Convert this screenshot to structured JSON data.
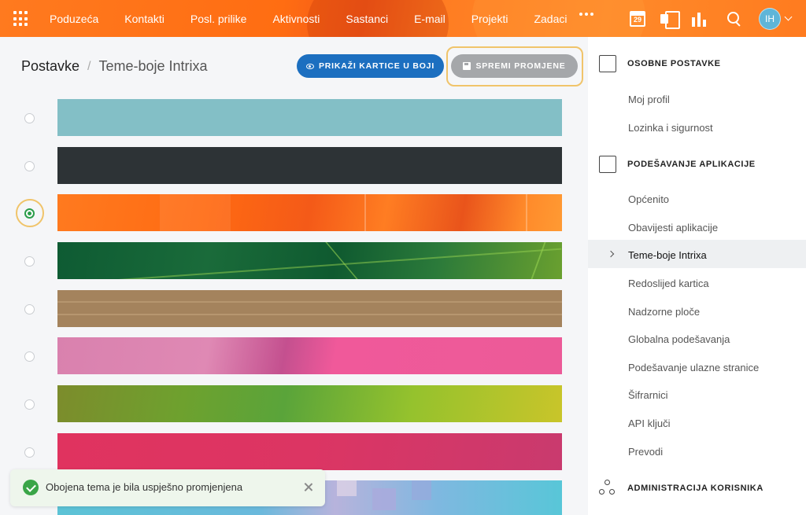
{
  "topbar": {
    "nav": [
      "Poduzeća",
      "Kontakti",
      "Posl. prilike",
      "Aktivnosti",
      "Sastanci",
      "E-mail",
      "Projekti",
      "Zadaci"
    ],
    "calendar_day": "29",
    "avatar_initials": "IH",
    "icons": [
      "apps-grid-icon",
      "more-dots-icon",
      "calendar-icon",
      "notes-icon",
      "bar-chart-icon",
      "search-icon",
      "chevron-down-icon"
    ]
  },
  "header": {
    "breadcrumb_root": "Postavke",
    "breadcrumb_current": "Teme-boje Intrixa",
    "show_cards_label": "PRIKAŽI KARTICE U BOJI",
    "save_label": "SPREMI PROMJENE"
  },
  "themes": [
    {
      "selected": false,
      "color": "#83bfc6"
    },
    {
      "selected": false,
      "color": "#2d3336"
    },
    {
      "selected": true,
      "color": "#ff7a1f"
    },
    {
      "selected": false,
      "color": "#1a6b3a"
    },
    {
      "selected": false,
      "color": "#a4835d"
    },
    {
      "selected": false,
      "color": "#ec5a98"
    },
    {
      "selected": false,
      "color": "#6ea12e"
    },
    {
      "selected": false,
      "color": "#dc3563"
    },
    {
      "selected": false,
      "color": "#5cc3d6"
    }
  ],
  "toast": {
    "message": "Obojena tema je bila uspješno promjenjena"
  },
  "sidebar": {
    "section_personal": "OSOBNE POSTAVKE",
    "personal_items": [
      "Moj profil",
      "Lozinka i sigurnost"
    ],
    "section_app": "PODEŠAVANJE APLIKACIJE",
    "app_items": [
      "Općenito",
      "Obavijesti aplikacije",
      "Teme-boje Intrixa",
      "Redoslijed kartica",
      "Nadzorne ploče",
      "Globalna podešavanja",
      "Podešavanje ulazne stranice",
      "Šifrarnici",
      "API ključi",
      "Prevodi"
    ],
    "active_item": "Teme-boje Intrixa",
    "section_admin": "ADMINISTRACIJA KORISNIKA"
  },
  "colors": {
    "accent_orange": "#ff7a1f",
    "primary_blue": "#1c6fc0",
    "success_green": "#3aa547",
    "highlight_gold": "#f0c46a"
  }
}
